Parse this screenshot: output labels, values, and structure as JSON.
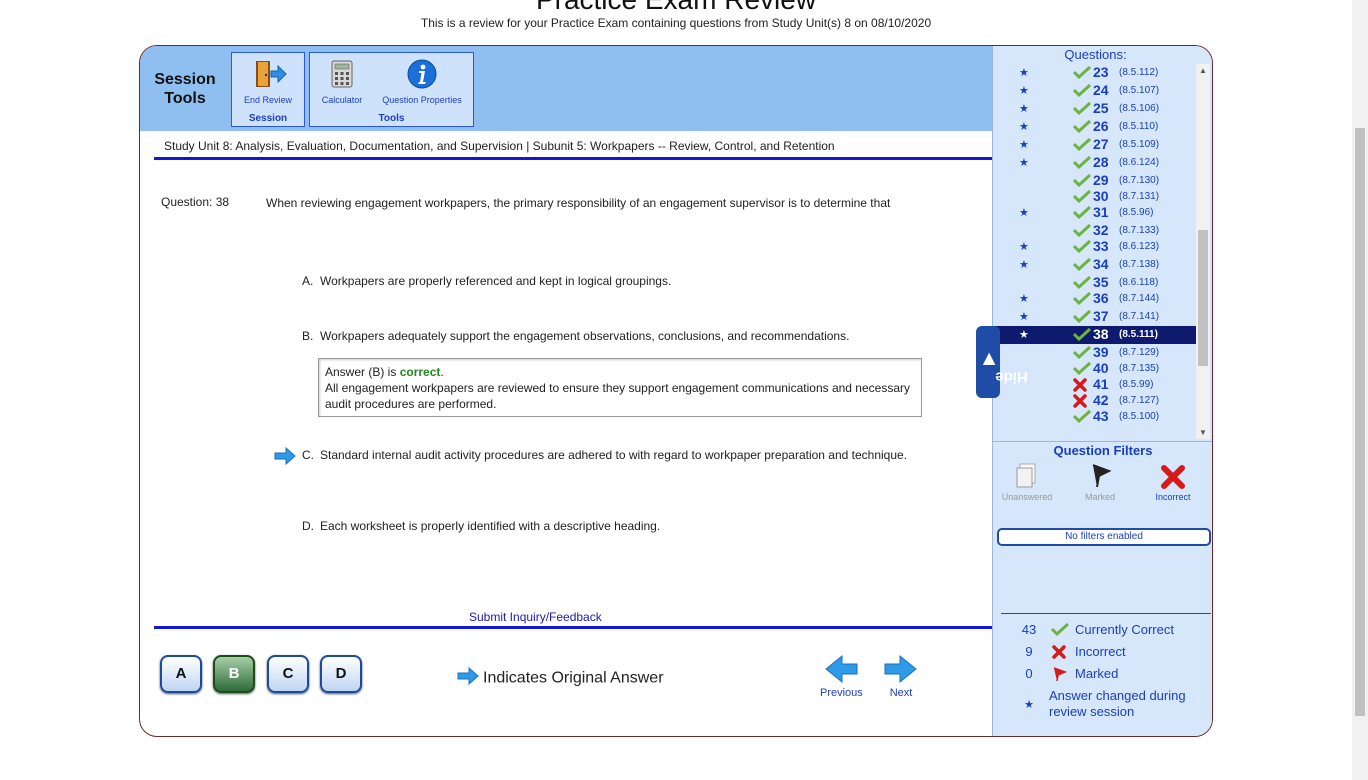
{
  "header": {
    "title": "Practice Exam Review",
    "subtitle": "This is a review for your Practice Exam containing questions from Study Unit(s) 8 on 08/10/2020"
  },
  "toolbar": {
    "session_tools_label": "Session Tools",
    "session_group_label": "Session",
    "tools_group_label": "Tools",
    "end_review_label": "End Review",
    "calculator_label": "Calculator",
    "question_properties_label": "Question Properties"
  },
  "breadcrumb": "Study Unit 8: Analysis, Evaluation, Documentation, and Supervision | Subunit 5: Workpapers -- Review, Control, and Retention",
  "question": {
    "number_label": "Question: 38",
    "text": "When reviewing engagement workpapers, the primary responsibility of an engagement supervisor is to determine that",
    "options": [
      {
        "letter": "A.",
        "text": "Workpapers are properly referenced and kept in logical groupings."
      },
      {
        "letter": "B.",
        "text": "Workpapers adequately support the engagement observations, conclusions, and recommendations."
      },
      {
        "letter": "C.",
        "text": "Standard internal audit activity procedures are adhered to with regard to workpaper preparation and technique."
      },
      {
        "letter": "D.",
        "text": "Each worksheet is properly identified with a descriptive heading."
      }
    ],
    "answer_prefix": "Answer (B) is ",
    "answer_status": "correct",
    "answer_suffix": ".",
    "explanation": "All engagement workpapers are reviewed to ensure they support engagement communications and necessary audit procedures are performed."
  },
  "submit_link": "Submit Inquiry/Feedback",
  "answer_buttons": [
    "A",
    "B",
    "C",
    "D"
  ],
  "selected_answer": "B",
  "legend_original": "Indicates Original Answer",
  "nav": {
    "previous": "Previous",
    "next": "Next"
  },
  "sidebar": {
    "header": "Questions:",
    "hide_label": "Hide",
    "questions": [
      {
        "num": "23",
        "ref": "(8.5.112)",
        "star": "★",
        "status": "correct"
      },
      {
        "num": "24",
        "ref": "(8.5.107)",
        "star": "★",
        "status": "correct"
      },
      {
        "num": "25",
        "ref": "(8.5.106)",
        "star": "★",
        "status": "correct"
      },
      {
        "num": "26",
        "ref": "(8.5.110)",
        "star": "★",
        "status": "correct"
      },
      {
        "num": "27",
        "ref": "(8.5.109)",
        "star": "★",
        "status": "correct"
      },
      {
        "num": "28",
        "ref": "(8.6.124)",
        "star": "★",
        "status": "correct"
      },
      {
        "num": "29",
        "ref": "(8.7.130)",
        "star": "",
        "status": "correct"
      },
      {
        "num": "30",
        "ref": "(8.7.131)",
        "star": "",
        "status": "correct"
      },
      {
        "num": "31",
        "ref": "(8.5.96)",
        "star": "★",
        "status": "correct"
      },
      {
        "num": "32",
        "ref": "(8.7.133)",
        "star": "",
        "status": "correct"
      },
      {
        "num": "33",
        "ref": "(8.6.123)",
        "star": "★",
        "status": "correct"
      },
      {
        "num": "34",
        "ref": "(8.7.138)",
        "star": "★",
        "status": "correct"
      },
      {
        "num": "35",
        "ref": "(8.6.118)",
        "star": "",
        "status": "correct"
      },
      {
        "num": "36",
        "ref": "(8.7.144)",
        "star": "★",
        "status": "correct"
      },
      {
        "num": "37",
        "ref": "(8.7.141)",
        "star": "★",
        "status": "correct"
      },
      {
        "num": "38",
        "ref": "(8.5.111)",
        "star": "★",
        "status": "correct"
      },
      {
        "num": "39",
        "ref": "(8.7.129)",
        "star": "",
        "status": "correct"
      },
      {
        "num": "40",
        "ref": "(8.7.135)",
        "star": "",
        "status": "correct"
      },
      {
        "num": "41",
        "ref": "(8.5.99)",
        "star": "",
        "status": "incorrect"
      },
      {
        "num": "42",
        "ref": "(8.7.127)",
        "star": "",
        "status": "incorrect"
      },
      {
        "num": "43",
        "ref": "(8.5.100)",
        "star": "",
        "status": "correct"
      }
    ],
    "current_question": "38",
    "filters_title": "Question Filters",
    "filters": {
      "unanswered": "Unanswered",
      "marked": "Marked",
      "incorrect": "Incorrect"
    },
    "filter_status": "No filters enabled",
    "stats": {
      "correct_count": "43",
      "correct_label": "Currently Correct",
      "incorrect_count": "9",
      "incorrect_label": "Incorrect",
      "marked_count": "0",
      "marked_label": "Marked",
      "changed_symbol": "★",
      "changed_label": "Answer changed during review session"
    }
  },
  "colors": {
    "accent": "#1a3fbd",
    "toolbar_bg": "#8ebff0",
    "sidebar_bg": "#d6e6fb",
    "correct": "#1f8a1f",
    "incorrect": "#d61a1a"
  }
}
